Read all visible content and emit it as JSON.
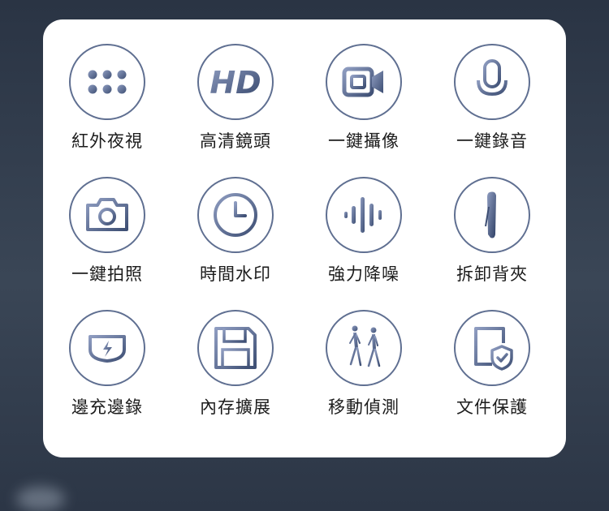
{
  "features": [
    {
      "label": "紅外夜視",
      "icon": "dots-grid-icon"
    },
    {
      "label": "高清鏡頭",
      "icon": "hd-icon",
      "icon_text": "HD"
    },
    {
      "label": "一鍵攝像",
      "icon": "video-camera-icon"
    },
    {
      "label": "一鍵錄音",
      "icon": "microphone-icon"
    },
    {
      "label": "一鍵拍照",
      "icon": "photo-camera-icon"
    },
    {
      "label": "時間水印",
      "icon": "clock-icon"
    },
    {
      "label": "強力降噪",
      "icon": "sound-wave-icon"
    },
    {
      "label": "拆卸背夾",
      "icon": "back-clip-icon"
    },
    {
      "label": "邊充邊錄",
      "icon": "power-plug-icon"
    },
    {
      "label": "內存擴展",
      "icon": "floppy-disk-icon"
    },
    {
      "label": "移動偵測",
      "icon": "walking-people-icon"
    },
    {
      "label": "文件保護",
      "icon": "document-shield-icon"
    }
  ],
  "colors": {
    "icon": "#5f6f91",
    "icon_dark": "#3e4f74",
    "card": "#ffffff",
    "label": "#1c1c1c"
  }
}
